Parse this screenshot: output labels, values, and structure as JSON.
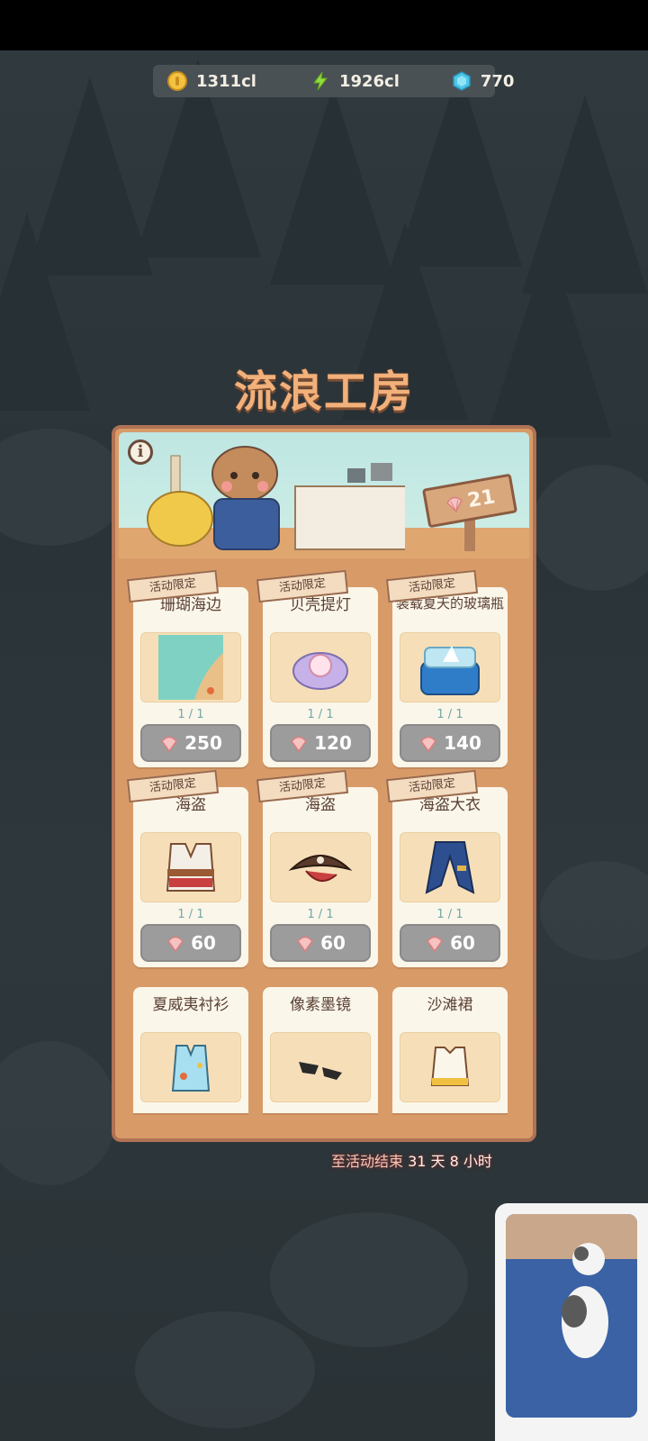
{
  "currency": {
    "coins": "1311cl",
    "energy": "1926cl",
    "gems": "770"
  },
  "title": "流浪工房",
  "shell_count": "21",
  "items": [
    {
      "name": "珊瑚海边",
      "stock": "1 / 1",
      "price": "250",
      "tag": "活动限定"
    },
    {
      "name": "贝壳提灯",
      "stock": "1 / 1",
      "price": "120",
      "tag": "活动限定"
    },
    {
      "name": "装载夏天的玻璃瓶",
      "stock": "1 / 1",
      "price": "140",
      "tag": "活动限定"
    },
    {
      "name": "海盗",
      "stock": "1 / 1",
      "price": "60",
      "tag": "活动限定"
    },
    {
      "name": "海盗",
      "stock": "1 / 1",
      "price": "60",
      "tag": "活动限定"
    },
    {
      "name": "海盗大衣",
      "stock": "1 / 1",
      "price": "60",
      "tag": "活动限定"
    },
    {
      "name": "夏威夷衬衫",
      "stock": "",
      "price": "",
      "tag": ""
    },
    {
      "name": "像素墨镜",
      "stock": "",
      "price": "",
      "tag": ""
    },
    {
      "name": "沙滩裙",
      "stock": "",
      "price": "",
      "tag": ""
    }
  ],
  "countdown": {
    "prefix": "至活动结束",
    "value": "31 天 8 小时"
  },
  "colors": {
    "title": "#f2b07a",
    "panel": "#d89b68",
    "price_button": "#9c9c9c",
    "stock_text": "#6fa8a6"
  },
  "icons": [
    "coin-icon",
    "energy-icon",
    "gem-icon",
    "info-icon",
    "shell-icon"
  ]
}
